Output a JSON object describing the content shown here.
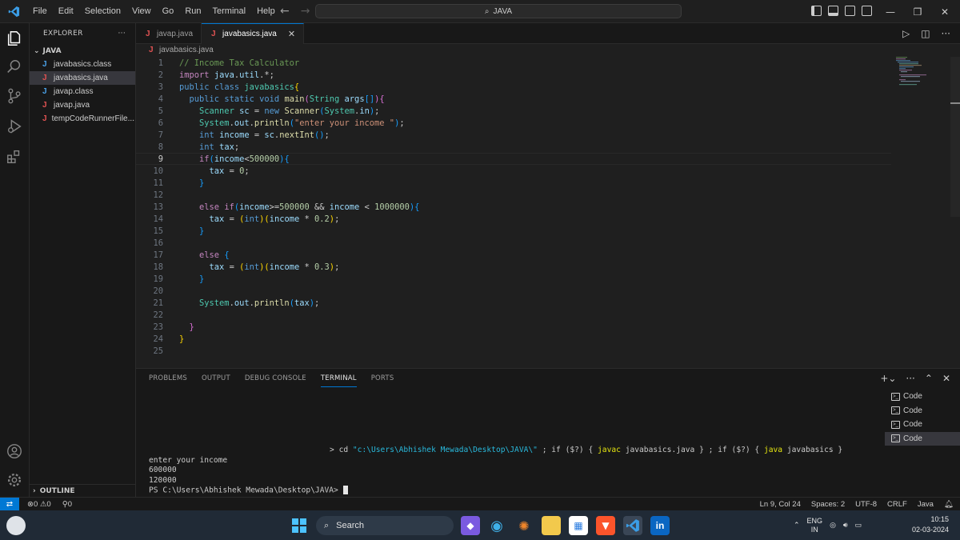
{
  "menu": [
    "File",
    "Edit",
    "Selection",
    "View",
    "Go",
    "Run",
    "Terminal",
    "Help"
  ],
  "search": {
    "text": "JAVA"
  },
  "explorer": {
    "title": "EXPLORER",
    "more": "···",
    "folder": "JAVA",
    "files": [
      {
        "name": "javabasics.class",
        "icon": "J",
        "kind": "class"
      },
      {
        "name": "javabasics.java",
        "icon": "J",
        "kind": "java"
      },
      {
        "name": "javap.class",
        "icon": "J",
        "kind": "class"
      },
      {
        "name": "javap.java",
        "icon": "J",
        "kind": "java"
      },
      {
        "name": "tempCodeRunnerFile....",
        "icon": "J",
        "kind": "java"
      }
    ],
    "outline": "OUTLINE"
  },
  "tabs": [
    {
      "label": "javap.java",
      "icon": "J"
    },
    {
      "label": "javabasics.java",
      "icon": "J",
      "close": "✕"
    }
  ],
  "breadcrumb": {
    "icon": "J",
    "label": "javabasics.java"
  },
  "editor": {
    "current_line": 9,
    "lines": [
      "1",
      "2",
      "3",
      "4",
      "5",
      "6",
      "7",
      "8",
      "9",
      "10",
      "11",
      "12",
      "13",
      "14",
      "15",
      "16",
      "17",
      "18",
      "19",
      "20",
      "21",
      "22",
      "23",
      "24",
      "25"
    ]
  },
  "panel": {
    "tabs": [
      "PROBLEMS",
      "OUTPUT",
      "DEBUG CONSOLE",
      "TERMINAL",
      "PORTS"
    ],
    "active_tab": "TERMINAL",
    "terminal": {
      "cmd_prompt": "> ",
      "cmd_1": "cd ",
      "cmd_path": "\"c:\\Users\\Abhishek Mewada\\Desktop\\JAVA\\\"",
      "cmd_2": " ; if ($?) { ",
      "cmd_javac": "javac",
      "cmd_3": " javabasics.java } ; if ($?) { ",
      "cmd_java": "java",
      "cmd_4": " javabasics }",
      "output": [
        "enter your income",
        "600000",
        "120000"
      ],
      "prompt": "PS C:\\Users\\Abhishek Mewada\\Desktop\\JAVA> "
    },
    "terminal_list": [
      "Code",
      "Code",
      "Code",
      "Code"
    ]
  },
  "status": {
    "errors": "0",
    "warnings": "0",
    "ports": "0",
    "position": "Ln 9, Col 24",
    "spaces": "Spaces: 2",
    "encoding": "UTF-8",
    "eol": "CRLF",
    "language": "Java"
  },
  "taskbar": {
    "search": "Search",
    "lang": "ENG",
    "region": "IN",
    "time": "10:15",
    "date": "02-03-2024"
  }
}
